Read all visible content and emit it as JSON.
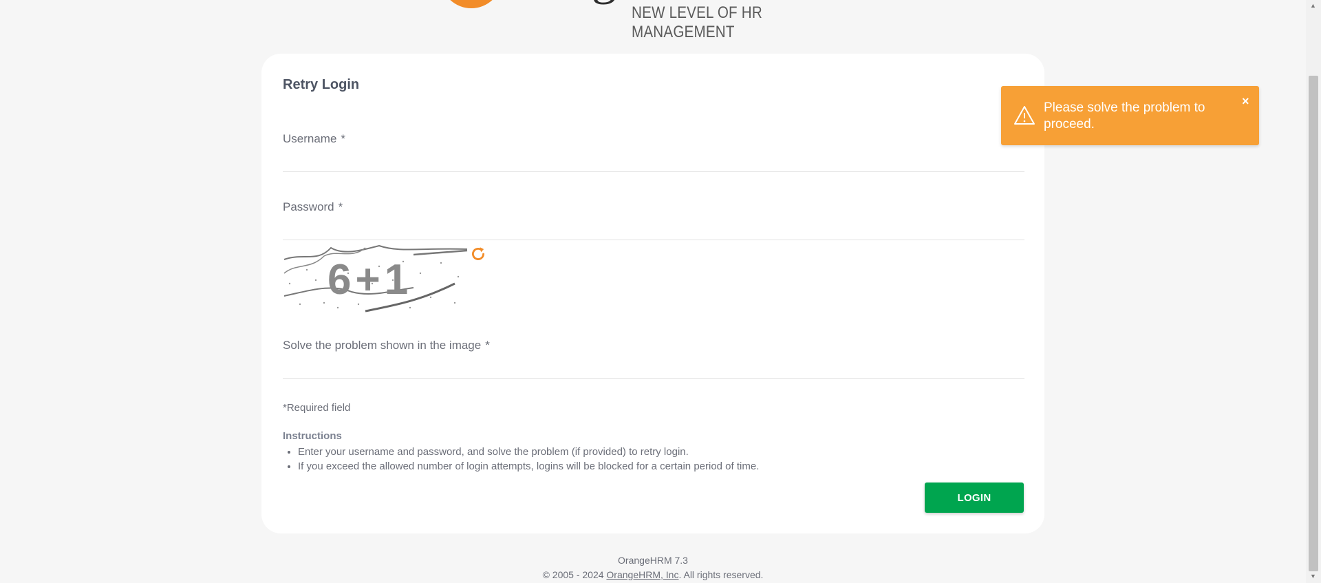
{
  "header": {
    "tagline": "NEW LEVEL OF HR MANAGEMENT",
    "logo_letters": "g"
  },
  "login_form": {
    "title": "Retry Login",
    "username_label": "Username",
    "password_label": "Password",
    "captcha_label": "Solve the problem shown in the image",
    "required_mark": "*",
    "required_note": "Required field",
    "captcha_text": "6+1",
    "instructions_title": "Instructions",
    "instructions": [
      "Enter your username and password, and solve the problem (if provided) to retry login.",
      "If you exceed the allowed number of login attempts, logins will be blocked for a certain period of time."
    ],
    "login_button": "LOGIN"
  },
  "footer": {
    "version": "OrangeHRM 7.3",
    "copyright_prefix": "© 2005 - 2024 ",
    "company_link": "OrangeHRM, Inc",
    "copyright_suffix": ". All rights reserved."
  },
  "toast": {
    "message": "Please solve the problem to proceed.",
    "close": "×",
    "icon": "warning-icon"
  },
  "colors": {
    "accent": "#f28c28",
    "login_button": "#00a54f",
    "toast": "#f7a036"
  }
}
